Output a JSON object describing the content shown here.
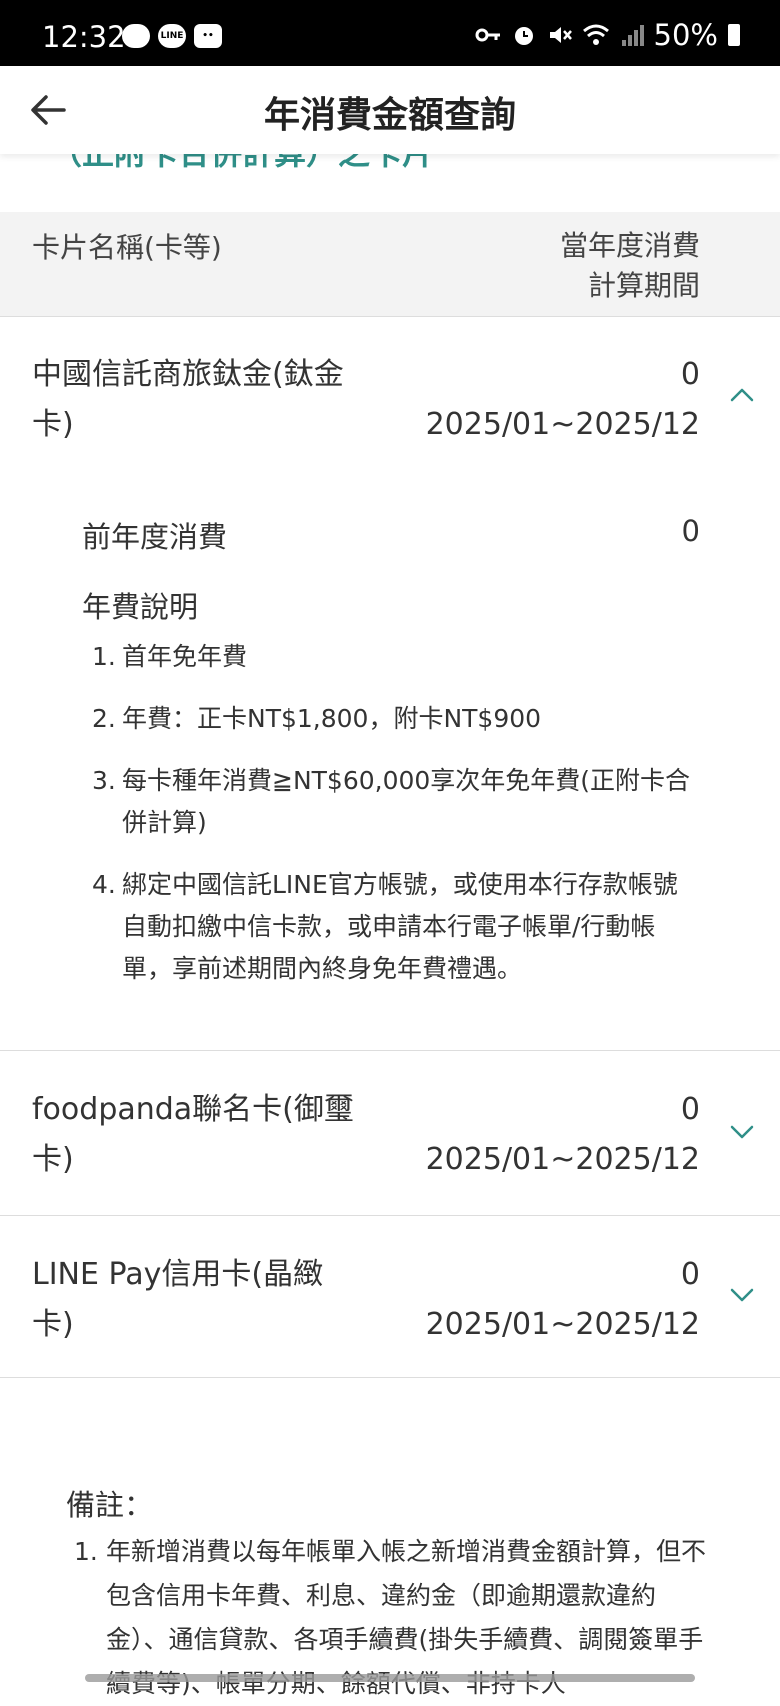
{
  "status_bar": {
    "time": "12:32",
    "battery": "50%",
    "left_icons": [
      "chat-bubble-icon",
      "line-app-icon",
      "robot-app-icon"
    ],
    "right_icons": [
      "vpn-key-icon",
      "alarm-icon",
      "mute-icon",
      "wifi-icon",
      "signal-icon",
      "battery-icon"
    ]
  },
  "header": {
    "title": "年消費金額查詢",
    "back_icon": "arrow-left-icon"
  },
  "clipped_heading": "（正附卡合併計算）之卡片",
  "table_header": {
    "col_card": "卡片名稱(卡等)",
    "col_spend_line1": "當年度消費",
    "col_spend_line2": "計算期間"
  },
  "cards": [
    {
      "name": "中國信託商旅鈦金(鈦金卡)",
      "spend": "0",
      "period": "2025/01~2025/12",
      "expanded": true
    },
    {
      "name": "foodpanda聯名卡(御璽卡)",
      "spend": "0",
      "period": "2025/01~2025/12",
      "expanded": false
    },
    {
      "name": "LINE Pay信用卡(晶緻卡)",
      "spend": "0",
      "period": "2025/01~2025/12",
      "expanded": false
    }
  ],
  "detail": {
    "prev_label": "前年度消費",
    "prev_value": "0",
    "fee_title": "年費說明",
    "fee_items": [
      {
        "num": "1.",
        "text": "首年免年費"
      },
      {
        "num": "2.",
        "text": "年費：正卡NT$1,800，附卡NT$900"
      },
      {
        "num": "3.",
        "text": "每卡種年消費≧NT$60,000享次年免年費(正附卡合併計算)"
      },
      {
        "num": "4.",
        "text": "綁定中國信託LINE官方帳號，或使用本行存款帳號自動扣繳中信卡款，或申請本行電子帳單/行動帳單，享前述期間內終身免年費禮遇。"
      }
    ]
  },
  "notes": {
    "title": "備註：",
    "items": [
      {
        "num": "1.",
        "text": "年新增消費以每年帳單入帳之新增消費金額計算，但不包含信用卡年費、利息、違約金（即逾期還款違約金）、通信貸款、各項手續費(掛失手續費、調閱簽單手續費等)、帳單分期、餘額代償、非持卡人"
      }
    ]
  },
  "colors": {
    "accent": "#2f8f88",
    "header_bg": "#f3f3f3",
    "divider": "#dddddd"
  }
}
